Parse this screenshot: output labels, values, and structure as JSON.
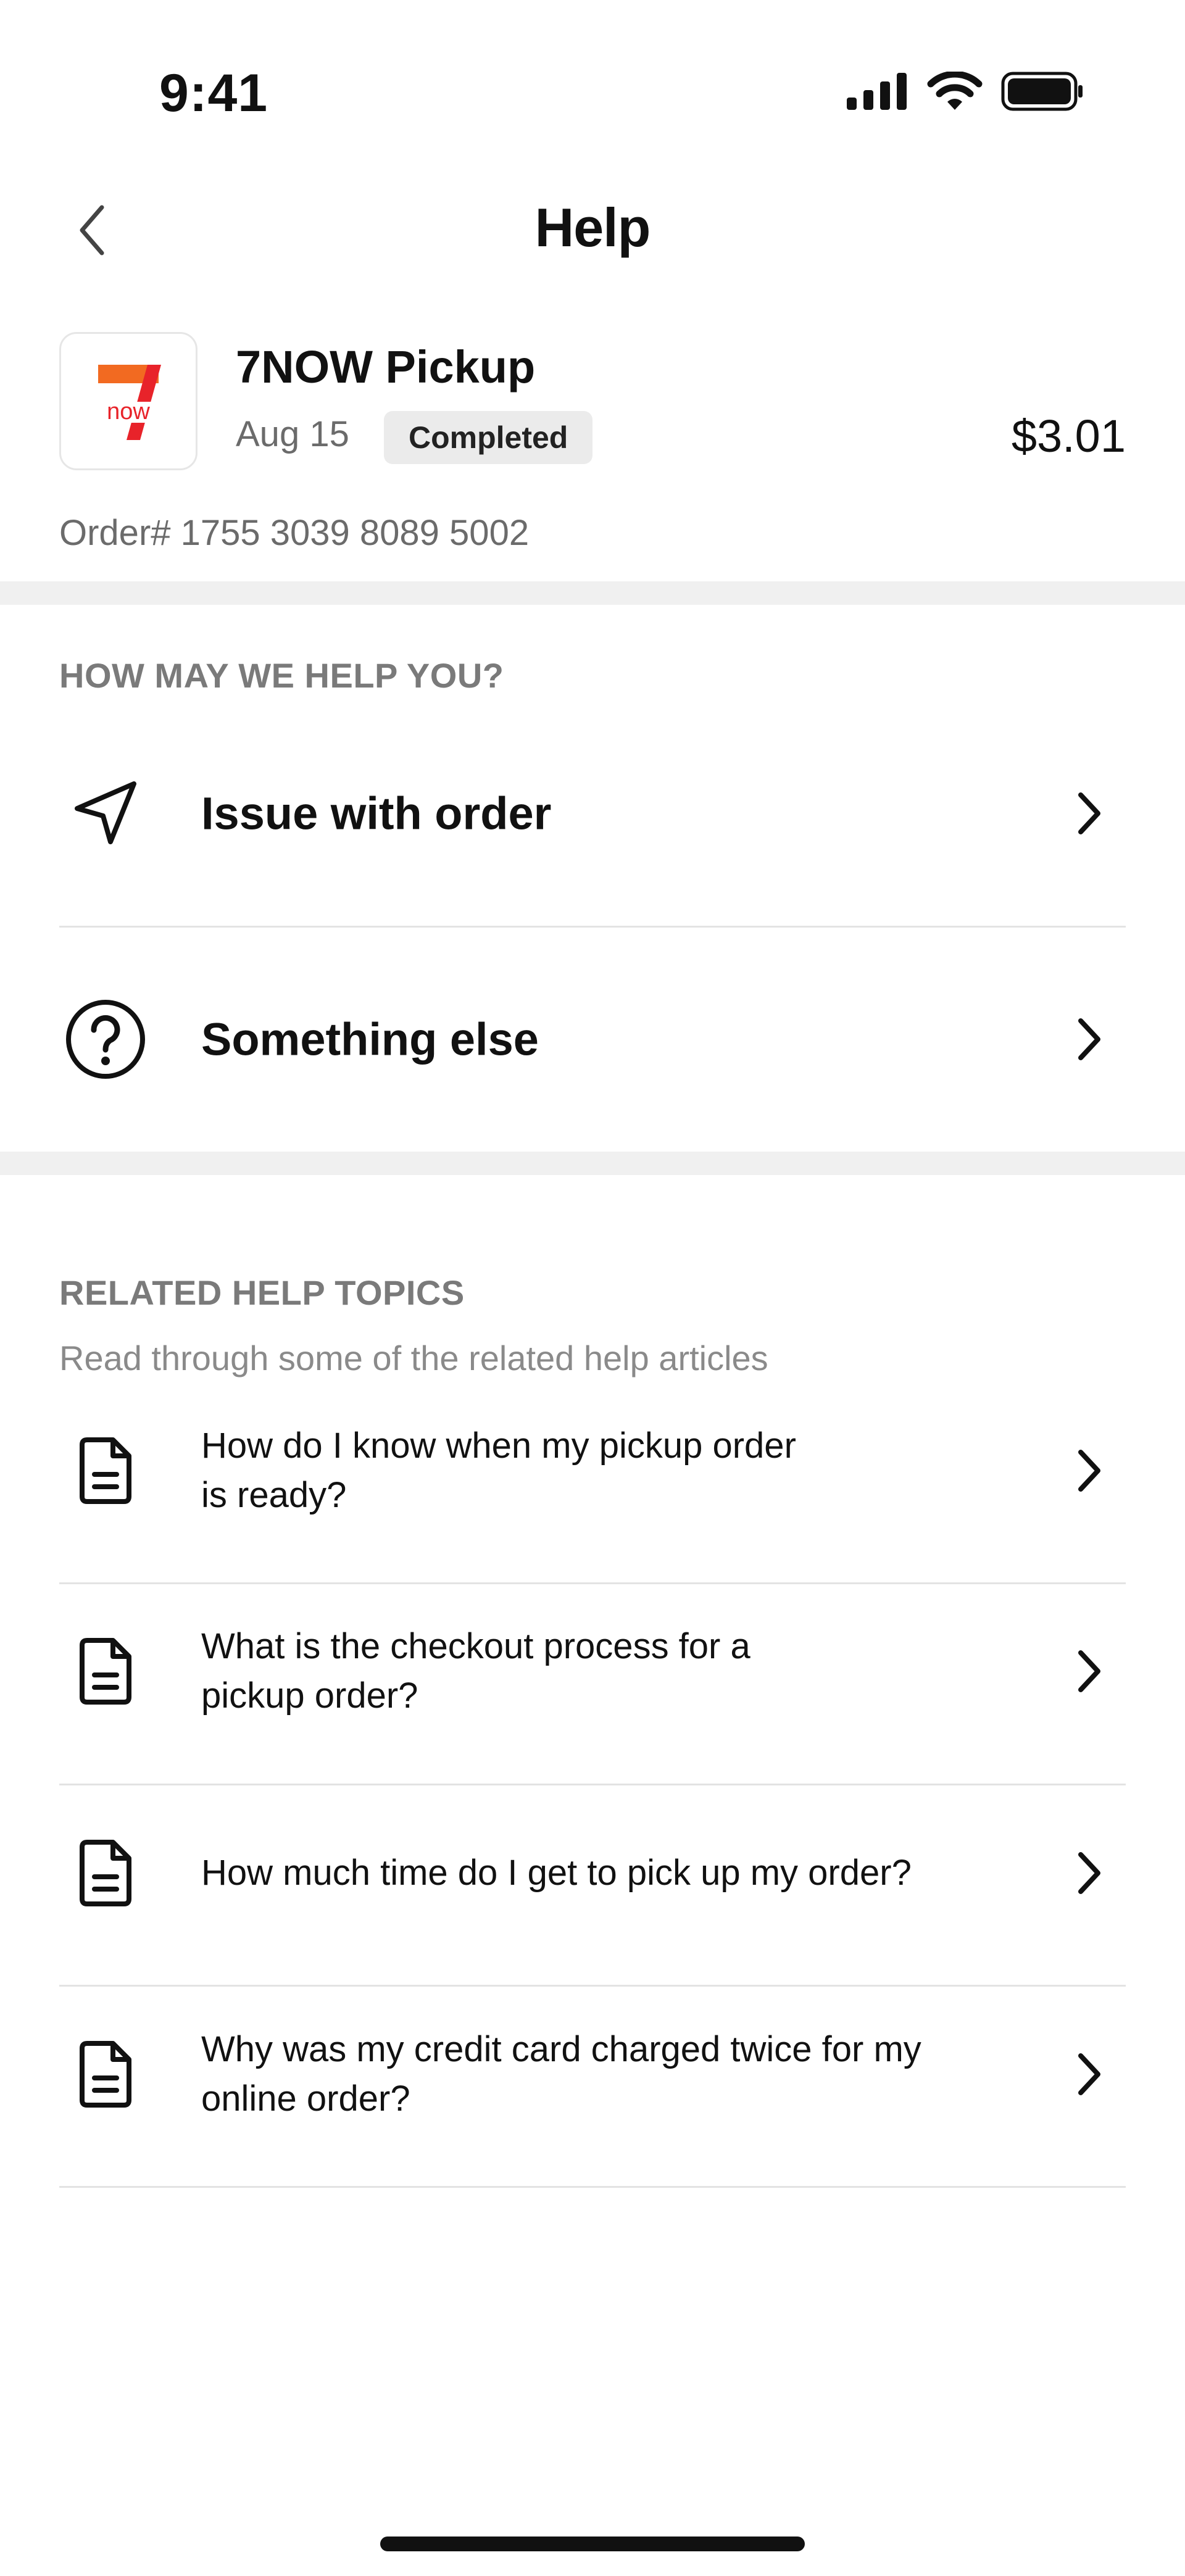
{
  "status_bar": {
    "time": "9:41",
    "icons": [
      "signal-icon",
      "wifi-icon",
      "battery-icon"
    ]
  },
  "nav": {
    "title": "Help",
    "back_icon": "chevron-left-icon"
  },
  "order": {
    "store_name": "7NOW Pickup",
    "logo_text": "now",
    "logo_numeral": "7",
    "date": "Aug 15",
    "status": "Completed",
    "price": "$3.01",
    "order_number": "Order# 1755 3039 8089 5002"
  },
  "help_section": {
    "heading": "HOW MAY WE HELP YOU?",
    "options": [
      {
        "label": "Issue with order",
        "icon": "navigation-arrow-icon"
      },
      {
        "label": "Something else",
        "icon": "question-circle-icon"
      }
    ]
  },
  "topics_section": {
    "heading": "RELATED HELP TOPICS",
    "subheading": "Read through some of the related help articles",
    "topics": [
      {
        "line1": "How do I know when my pickup order",
        "line2": "is ready?",
        "icon": "document-icon"
      },
      {
        "line1": "What is the checkout process for a",
        "line2": "pickup order?",
        "icon": "document-icon"
      },
      {
        "line1": "How much time do I get to pick up my order?",
        "line2": "",
        "icon": "document-icon"
      },
      {
        "line1": "Why was my credit card charged twice for my",
        "line2": "online order?",
        "icon": "document-icon"
      }
    ]
  },
  "colors": {
    "text_primary": "#111111",
    "text_secondary": "#6b6b6b",
    "divider": "#f0f0f0",
    "badge_bg": "#ebebeb",
    "logo_orange": "#f26a21",
    "logo_red": "#e8232a"
  }
}
